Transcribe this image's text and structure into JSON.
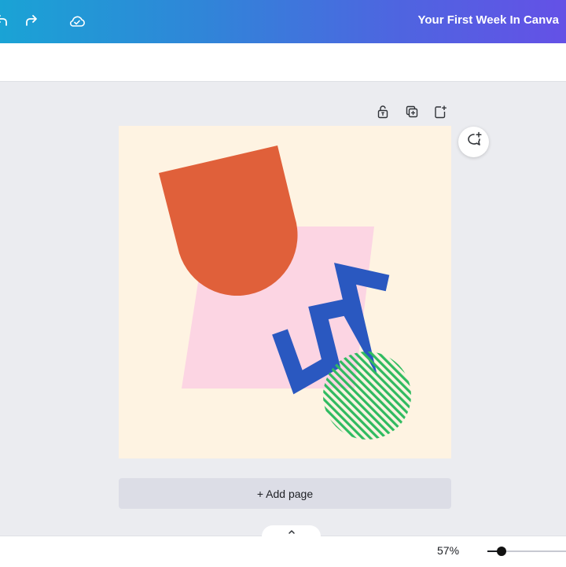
{
  "topbar": {
    "title": "Your First Week In Canva",
    "icons": [
      "undo-icon",
      "redo-icon",
      "cloud-saved-icon"
    ],
    "gradient": [
      "#1aa3d5",
      "#6451e6"
    ]
  },
  "page_actions": {
    "icons": [
      "lock-icon",
      "duplicate-page-icon",
      "add-page-icon"
    ]
  },
  "comment_button": {
    "icon": "add-comment-icon"
  },
  "design": {
    "background_color": "#fef3e2",
    "shapes": [
      {
        "name": "orange-arch-shape",
        "color": "#e0603a"
      },
      {
        "name": "pink-parallelogram-shape",
        "color": "#fcd5e3"
      },
      {
        "name": "blue-zigzag-shape",
        "color": "#2a58c0"
      },
      {
        "name": "green-striped-circle-shape",
        "color": "#2fbb60"
      }
    ]
  },
  "add_page": {
    "label": "+ Add page"
  },
  "footer": {
    "expand_icon": "chevron-up-icon",
    "zoom_label": "57%",
    "zoom_fraction": 0.18
  }
}
